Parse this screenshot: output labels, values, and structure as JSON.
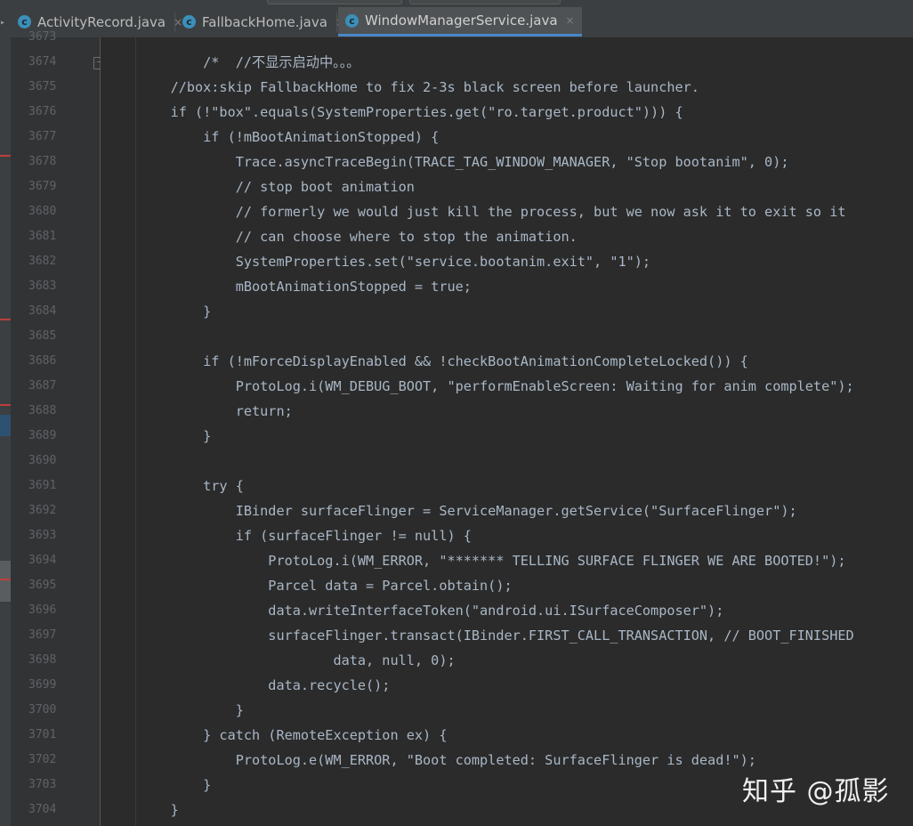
{
  "tabs": [
    {
      "label": "ActivityRecord.java",
      "icon": "class-icon",
      "active": false
    },
    {
      "label": "FallbackHome.java",
      "icon": "class-icon",
      "active": false
    },
    {
      "label": "WindowManagerService.java",
      "icon": "class-icon",
      "active": true
    }
  ],
  "tab_icon_letter": "c",
  "close_glyph": "×",
  "colors": {
    "accent": "#4a88c7",
    "background": "#2b2b2b",
    "gutter": "#313335",
    "error_mark": "#bc3f3c"
  },
  "editor": {
    "first_partial_line": "3673",
    "lines": [
      {
        "num": "3674",
        "text": "        /*  //不显示启动中。。。"
      },
      {
        "num": "3675",
        "text": "    //box:skip FallbackHome to fix 2-3s black screen before launcher."
      },
      {
        "num": "3676",
        "text": "    if (!\"box\".equals(SystemProperties.get(\"ro.target.product\"))) {"
      },
      {
        "num": "3677",
        "text": "        if (!mBootAnimationStopped) {"
      },
      {
        "num": "3678",
        "text": "            Trace.asyncTraceBegin(TRACE_TAG_WINDOW_MANAGER, \"Stop bootanim\", 0);"
      },
      {
        "num": "3679",
        "text": "            // stop boot animation"
      },
      {
        "num": "3680",
        "text": "            // formerly we would just kill the process, but we now ask it to exit so it"
      },
      {
        "num": "3681",
        "text": "            // can choose where to stop the animation."
      },
      {
        "num": "3682",
        "text": "            SystemProperties.set(\"service.bootanim.exit\", \"1\");"
      },
      {
        "num": "3683",
        "text": "            mBootAnimationStopped = true;"
      },
      {
        "num": "3684",
        "text": "        }"
      },
      {
        "num": "3685",
        "text": ""
      },
      {
        "num": "3686",
        "text": "        if (!mForceDisplayEnabled && !checkBootAnimationCompleteLocked()) {"
      },
      {
        "num": "3687",
        "text": "            ProtoLog.i(WM_DEBUG_BOOT, \"performEnableScreen: Waiting for anim complete\");"
      },
      {
        "num": "3688",
        "text": "            return;"
      },
      {
        "num": "3689",
        "text": "        }"
      },
      {
        "num": "3690",
        "text": ""
      },
      {
        "num": "3691",
        "text": "        try {"
      },
      {
        "num": "3692",
        "text": "            IBinder surfaceFlinger = ServiceManager.getService(\"SurfaceFlinger\");"
      },
      {
        "num": "3693",
        "text": "            if (surfaceFlinger != null) {"
      },
      {
        "num": "3694",
        "text": "                ProtoLog.i(WM_ERROR, \"******* TELLING SURFACE FLINGER WE ARE BOOTED!\");"
      },
      {
        "num": "3695",
        "text": "                Parcel data = Parcel.obtain();"
      },
      {
        "num": "3696",
        "text": "                data.writeInterfaceToken(\"android.ui.ISurfaceComposer\");"
      },
      {
        "num": "3697",
        "text": "                surfaceFlinger.transact(IBinder.FIRST_CALL_TRANSACTION, // BOOT_FINISHED"
      },
      {
        "num": "3698",
        "text": "                        data, null, 0);"
      },
      {
        "num": "3699",
        "text": "                data.recycle();"
      },
      {
        "num": "3700",
        "text": "            }"
      },
      {
        "num": "3701",
        "text": "        } catch (RemoteException ex) {"
      },
      {
        "num": "3702",
        "text": "            ProtoLog.e(WM_ERROR, \"Boot completed: SurfaceFlinger is dead!\");"
      },
      {
        "num": "3703",
        "text": "        }"
      },
      {
        "num": "3704",
        "text": "    }"
      }
    ]
  },
  "watermark": "知乎 @孤影"
}
